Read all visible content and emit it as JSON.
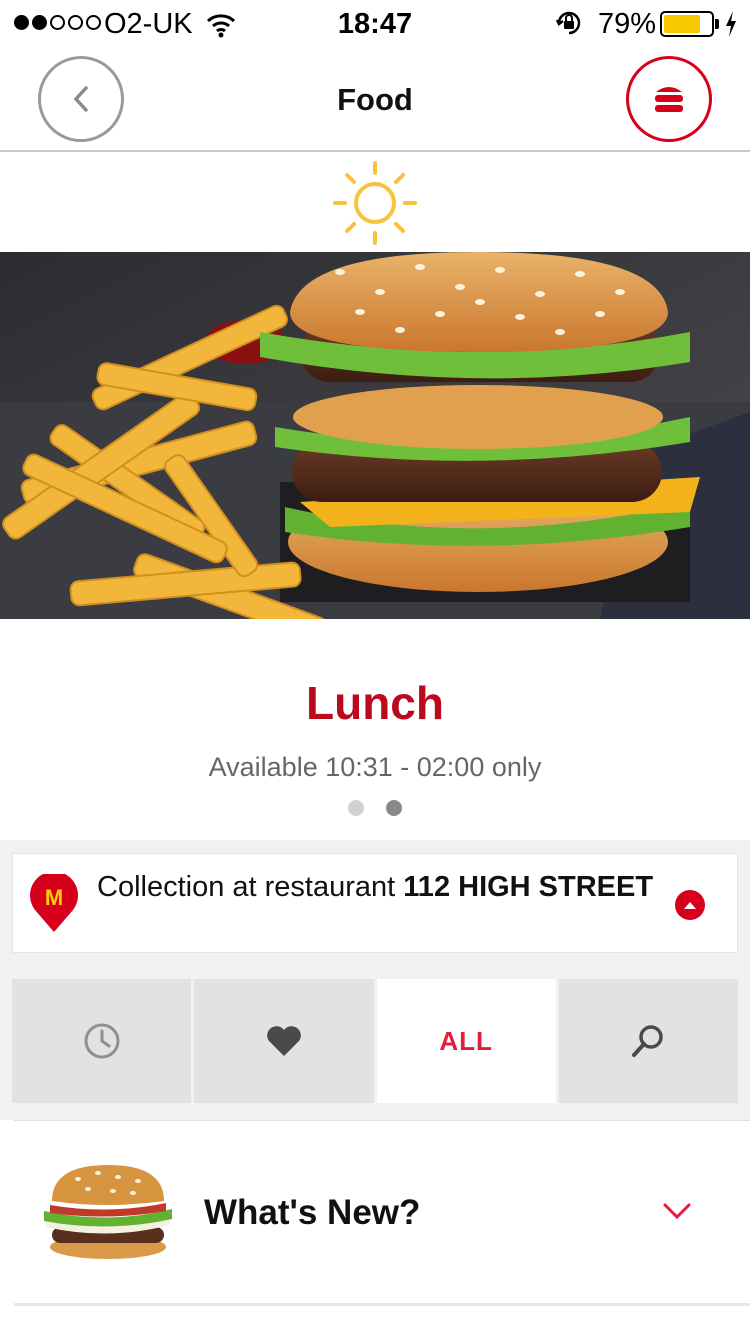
{
  "status_bar": {
    "carrier": "O2-UK",
    "time": "18:47",
    "battery_percent": "79%",
    "battery_level": 0.79,
    "signal_bars_filled": 2,
    "signal_bars_total": 5,
    "icons": [
      "wifi-icon",
      "rotation-lock-icon",
      "battery-icon",
      "charging-bolt-icon"
    ]
  },
  "header": {
    "title": "Food",
    "back_icon": "chevron-left-icon",
    "menu_icon": "burger-menu-icon",
    "accent_color": "#d7001b"
  },
  "daypart": {
    "icon": "sun-icon",
    "icon_color": "#f7c23c"
  },
  "hero": {
    "image": "burger-and-fries-photo"
  },
  "meal": {
    "title": "Lunch",
    "availability": "Available 10:31 - 02:00 only",
    "pager_total": 2,
    "pager_active": 2,
    "title_color": "#bb0a1e"
  },
  "collection": {
    "prefix": "Collection at restaurant ",
    "restaurant": "112 HIGH STREET",
    "pin_icon": "mcdonalds-pin-icon",
    "toggle_icon": "chevron-up-icon"
  },
  "filter_tabs": [
    {
      "id": "recent",
      "icon": "clock-icon",
      "label": ""
    },
    {
      "id": "favourites",
      "icon": "heart-icon",
      "label": ""
    },
    {
      "id": "all",
      "icon": "",
      "label": "ALL",
      "active": true
    },
    {
      "id": "search",
      "icon": "search-icon",
      "label": ""
    }
  ],
  "categories": [
    {
      "label": "What's New?",
      "image": "burger-thumbnail",
      "icon": "chevron-down-icon"
    }
  ]
}
